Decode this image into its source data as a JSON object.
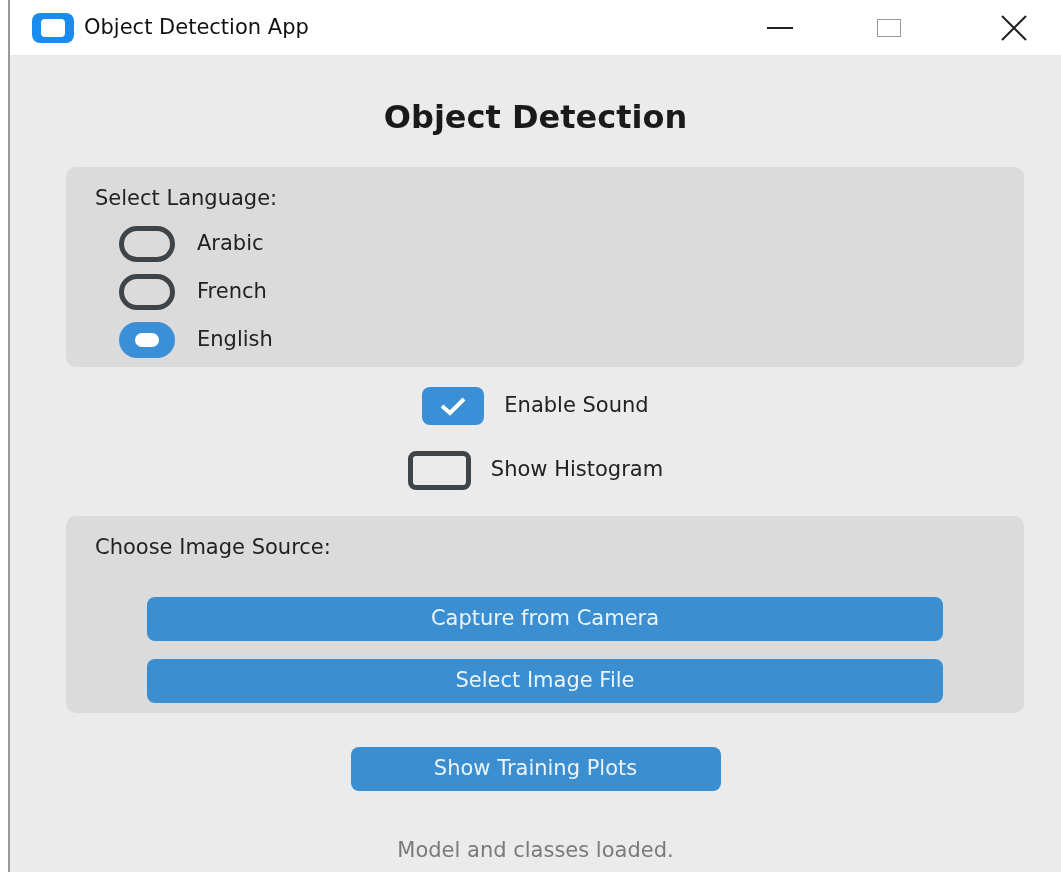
{
  "window": {
    "title": "Object Detection App"
  },
  "heading": "Object Detection",
  "language": {
    "label": "Select Language:",
    "options": [
      {
        "label": "Arabic",
        "selected": false
      },
      {
        "label": "French",
        "selected": false
      },
      {
        "label": "English",
        "selected": true
      }
    ]
  },
  "toggles": [
    {
      "label": "Enable Sound",
      "checked": true
    },
    {
      "label": "Show Histogram",
      "checked": false
    }
  ],
  "source": {
    "label": "Choose Image Source:",
    "buttons": [
      "Capture from Camera",
      "Select Image File"
    ]
  },
  "plots_button": "Show Training Plots",
  "status": "Model and classes loaded."
}
